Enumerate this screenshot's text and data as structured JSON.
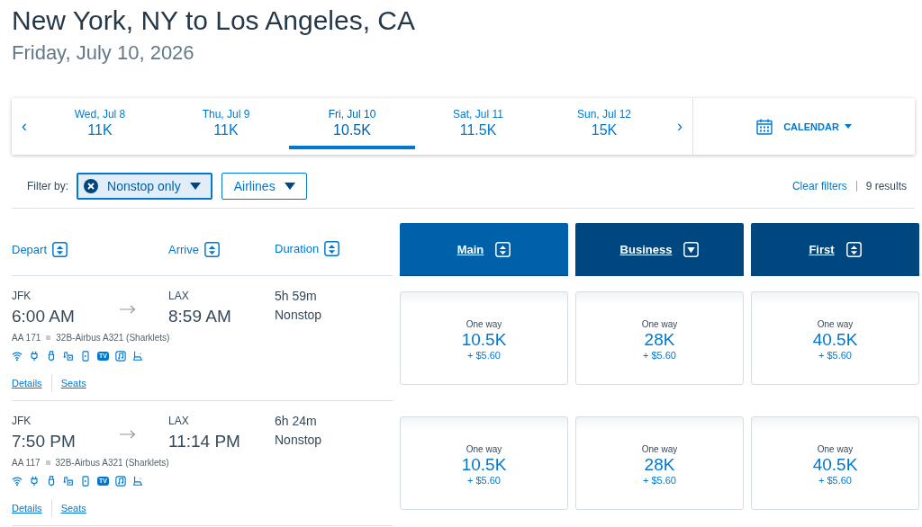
{
  "heading": {
    "title": "New York, NY to Los Angeles, CA",
    "date": "Friday, July 10, 2026"
  },
  "date_bar": {
    "days": [
      {
        "day": "Wed, Jul 8",
        "price": "11K",
        "selected": false
      },
      {
        "day": "Thu, Jul 9",
        "price": "11K",
        "selected": false
      },
      {
        "day": "Fri, Jul 10",
        "price": "10.5K",
        "selected": true
      },
      {
        "day": "Sat, Jul 11",
        "price": "11.5K",
        "selected": false
      },
      {
        "day": "Sun, Jul 12",
        "price": "15K",
        "selected": false
      }
    ],
    "prev": "‹",
    "next": "›",
    "calendar": "CALENDAR"
  },
  "filters": {
    "label": "Filter by:",
    "chips": [
      {
        "label": "Nonstop only",
        "active": true
      },
      {
        "label": "Airlines",
        "active": false
      }
    ],
    "clear": "Clear filters",
    "results": "9 results"
  },
  "columns": [
    {
      "label": "Depart",
      "kind": "sortable"
    },
    {
      "label": "Arrive",
      "kind": "sortable"
    },
    {
      "label": "Duration",
      "kind": "sortable"
    }
  ],
  "cabins": [
    {
      "label": "Main",
      "kind": "sortable",
      "selected": true
    },
    {
      "label": "Business",
      "kind": "descending",
      "selected": false
    },
    {
      "label": "First",
      "kind": "sortable",
      "selected": false
    }
  ],
  "flights": [
    {
      "from": "JFK",
      "depart": "6:00 AM",
      "to": "LAX",
      "arrive": "8:59 AM",
      "duration": "5h 59m",
      "stops": "Nonstop",
      "flight": "AA 171",
      "aircraft": "32B-Airbus A321 (Sharklets)",
      "links": [
        "Details",
        "Seats"
      ],
      "amenities": [
        {
          "kind": "wifi"
        },
        {
          "kind": "power"
        },
        {
          "kind": "usb"
        },
        {
          "kind": "entertainment"
        },
        {
          "kind": "phone"
        },
        {
          "kind": "tv",
          "label": "TV"
        },
        {
          "kind": "music"
        },
        {
          "kind": "seat"
        }
      ],
      "fares": [
        {
          "label": "One way",
          "price": "10.5K",
          "fee": "+ $5.60"
        },
        {
          "label": "One way",
          "price": "28K",
          "fee": "+ $5.60"
        },
        {
          "label": "One way",
          "price": "40.5K",
          "fee": "+ $5.60"
        }
      ]
    },
    {
      "from": "JFK",
      "depart": "7:50 PM",
      "to": "LAX",
      "arrive": "11:14 PM",
      "duration": "6h 24m",
      "stops": "Nonstop",
      "flight": "AA 117",
      "aircraft": "32B-Airbus A321 (Sharklets)",
      "links": [
        "Details",
        "Seats"
      ],
      "amenities": [
        {
          "kind": "wifi"
        },
        {
          "kind": "power"
        },
        {
          "kind": "usb"
        },
        {
          "kind": "entertainment"
        },
        {
          "kind": "phone"
        },
        {
          "kind": "tv",
          "label": "TV"
        },
        {
          "kind": "music"
        },
        {
          "kind": "seat"
        }
      ],
      "fares": [
        {
          "label": "One way",
          "price": "10.5K",
          "fee": "+ $5.60"
        },
        {
          "label": "One way",
          "price": "28K",
          "fee": "+ $5.60"
        },
        {
          "label": "One way",
          "price": "40.5K",
          "fee": "+ $5.60"
        }
      ]
    }
  ]
}
